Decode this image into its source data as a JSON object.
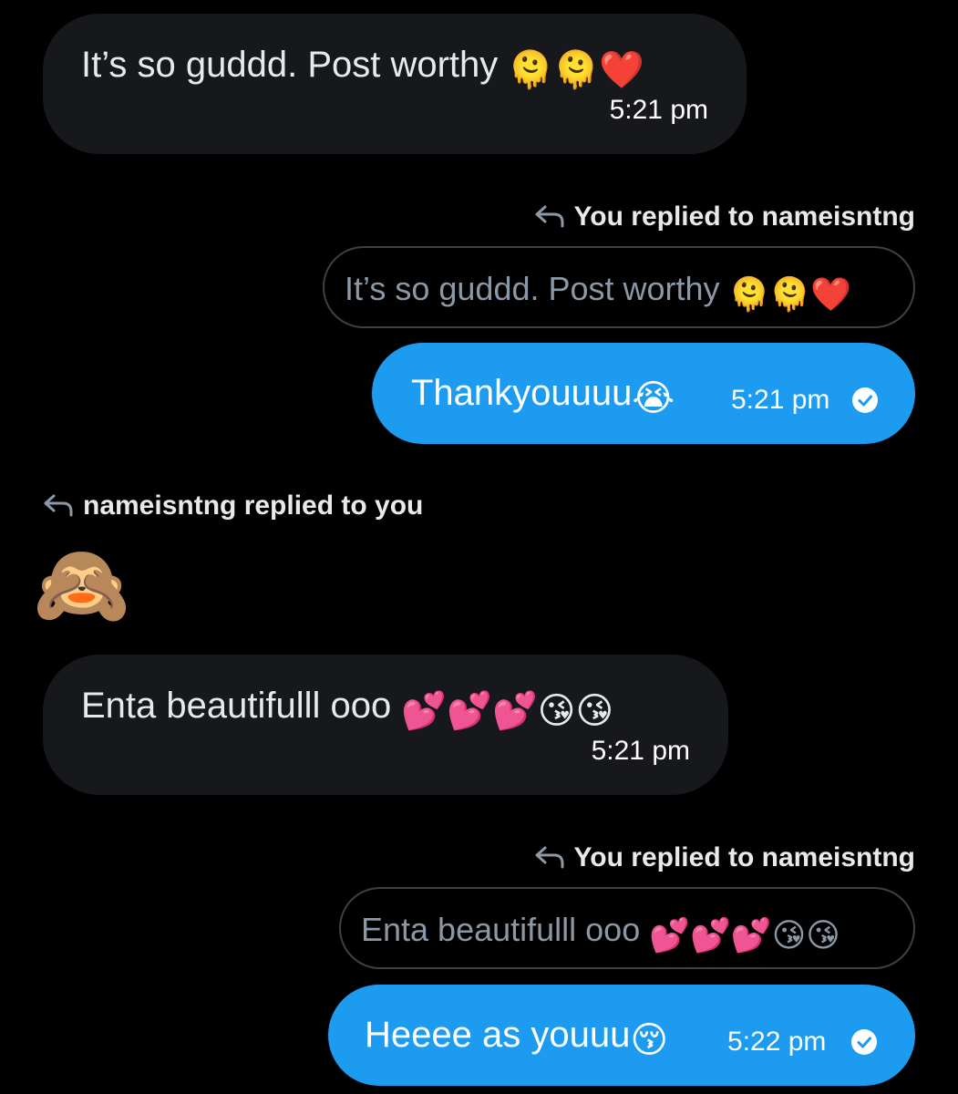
{
  "messages": [
    {
      "text": "It’s so guddd. Post worthy",
      "emojis": "🫠🫠❤️",
      "time": "5:21 pm"
    },
    {
      "reply_label": "You replied to nameisntng",
      "quote_text": "It’s so guddd. Post worthy",
      "quote_emojis": "🫠🫠❤️",
      "text": "Thankyouuuu",
      "emojis": "😭",
      "time": "5:21 pm",
      "status_icon": "check-circle-icon"
    },
    {
      "reply_label": "nameisntng replied to you",
      "sticker": "🙈"
    },
    {
      "text": "Enta beautifulll ooo",
      "emojis": "💕💕💕😘😘",
      "time": "5:21 pm"
    },
    {
      "reply_label": "You replied to nameisntng",
      "quote_text": "Enta beautifulll ooo",
      "quote_emojis": "💕💕💕😘😘",
      "text": "Heeee as youuu",
      "emojis": "😚",
      "time": "5:22 pm",
      "status_icon": "check-circle-icon"
    }
  ],
  "colors": {
    "background": "#000000",
    "incoming_bubble": "#16181c",
    "outgoing_bubble": "#1d9bf0",
    "quote_border": "#3e4144",
    "quote_text": "#8b98a5",
    "text": "#e7e9ea"
  }
}
